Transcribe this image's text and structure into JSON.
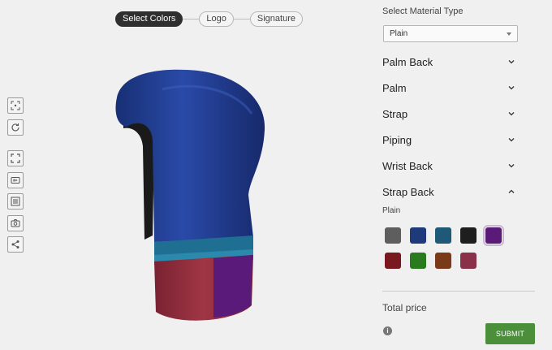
{
  "stepper": {
    "steps": [
      {
        "label": "Select Colors",
        "active": true
      },
      {
        "label": "Logo",
        "active": false
      },
      {
        "label": "Signature",
        "active": false
      }
    ]
  },
  "toolbar": {
    "icons": [
      "focus-icon",
      "rotate-icon",
      "fullscreen-icon",
      "media-icon",
      "list-icon",
      "camera-icon",
      "share-icon"
    ]
  },
  "glove": {
    "colors": {
      "shell": "#1e3a8a",
      "cuff": "#8b2a3a",
      "piping": "#1f6f92",
      "logo_panel": "#5a1a7a",
      "lining": "#1a1a1a"
    }
  },
  "panel": {
    "material_label": "Select Material Type",
    "material_value": "Plain",
    "sections": [
      {
        "label": "Palm Back",
        "expanded": false
      },
      {
        "label": "Palm",
        "expanded": false
      },
      {
        "label": "Strap",
        "expanded": false
      },
      {
        "label": "Piping",
        "expanded": false
      },
      {
        "label": "Wrist Back",
        "expanded": false
      },
      {
        "label": "Strap Back",
        "expanded": true
      }
    ],
    "plain_label": "Plain",
    "swatches": [
      {
        "color": "#5e5e5e",
        "selected": false
      },
      {
        "color": "#1f3a7a",
        "selected": false
      },
      {
        "color": "#1e5a78",
        "selected": false
      },
      {
        "color": "#1e1e1e",
        "selected": false
      },
      {
        "color": "#5a1a78",
        "selected": true
      },
      {
        "color": "#7a1820",
        "selected": false
      },
      {
        "color": "#2a7a1e",
        "selected": false
      },
      {
        "color": "#7a3a1a",
        "selected": false
      },
      {
        "color": "#8a3048",
        "selected": false
      }
    ],
    "total_price_label": "Total price",
    "submit_label": "SUBMIT"
  }
}
